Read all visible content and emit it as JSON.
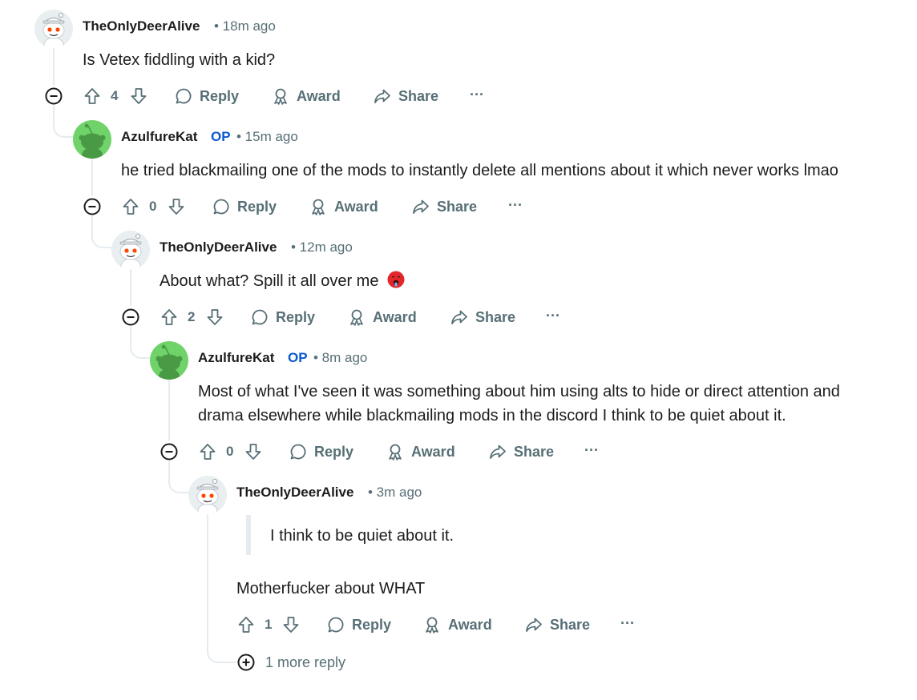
{
  "comments": [
    {
      "user": "TheOnlyDeerAlive",
      "op": "",
      "time": "• 18m ago",
      "text": "Is Vetex fiddling with a kid?",
      "votes": "4",
      "avatar": "snoo-white"
    },
    {
      "user": "AzulfureKat",
      "op": "OP",
      "time": "• 15m ago",
      "text": "he tried blackmailing one of the mods to instantly delete all mentions about it which never works lmao",
      "votes": "0",
      "avatar": "snoo-green"
    },
    {
      "user": "TheOnlyDeerAlive",
      "op": "",
      "time": "• 12m ago",
      "text": "About what? Spill it all over me",
      "emoji": "hot-face-emoji",
      "votes": "2",
      "avatar": "snoo-white"
    },
    {
      "user": "AzulfureKat",
      "op": "OP",
      "time": "• 8m ago",
      "text_line1": "Most of what I've seen it was something about him using alts to hide or direct attention and",
      "text_line2": "drama elsewhere while blackmailing mods in the discord I think to be quiet about it.",
      "votes": "0",
      "avatar": "snoo-green"
    },
    {
      "user": "TheOnlyDeerAlive",
      "op": "",
      "time": "• 3m ago",
      "quote": "I think to be quiet about it.",
      "text": "Motherfucker about WHAT",
      "votes": "1",
      "avatar": "snoo-white"
    }
  ],
  "actions": {
    "reply": "Reply",
    "award": "Award",
    "share": "Share",
    "more": "···"
  },
  "more_replies": "1 more reply",
  "colors": {
    "op": "#0a58d0",
    "meta": "#576f76",
    "thread": "#e5ebee",
    "green_avatar": "#6fd36a"
  }
}
